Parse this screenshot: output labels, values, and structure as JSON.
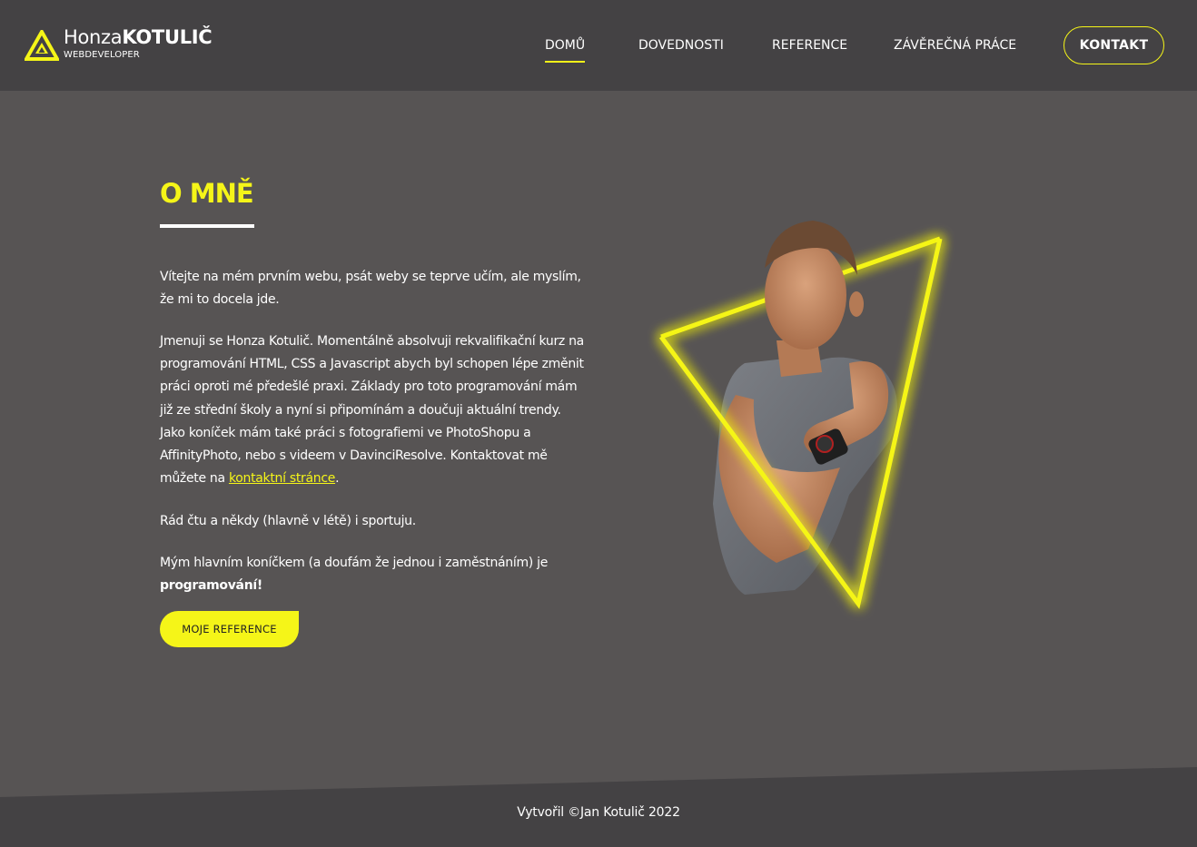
{
  "brand": {
    "first_name": "Honza",
    "last_name": "KOTULIČ",
    "tagline": "WEBDEVELOPER",
    "accent_color": "#f5f518"
  },
  "nav": {
    "items": [
      {
        "label": "DOMŮ",
        "active": true
      },
      {
        "label": "DOVEDNOSTI",
        "active": false
      },
      {
        "label": "REFERENCE",
        "active": false
      },
      {
        "label": "ZÁVĚREČNÁ PRÁCE",
        "active": false
      }
    ],
    "contact_label": "KONTAKT"
  },
  "main": {
    "title": "O MNĚ",
    "para1": "Vítejte na mém prvním webu, psát weby se teprve učím, ale myslím, že mi to docela jde.",
    "para2": "Jmenuji se Honza Kotulič. Momentálně absolvuji rekvalifikační kurz na programování HTML, CSS a Javascript abych byl schopen lépe změnit práci oproti mé předešlé praxi. Základy pro toto programování mám již ze střední školy a nyní si připomínám a doučuji aktuální trendy. Jako koníček mám také práci s fotografiemi ve PhotoShopu a AffinityPhoto, nebo s videem v DavinciResolve. Kontaktovat mě můžete na ",
    "para2_link": "kontaktní stránce",
    "para2_end": ".",
    "para3": "Rád čtu a někdy (hlavně v létě) i sportuju.",
    "para4": "Mým hlavním koníčkem (a doufám že jednou i zaměstnáním) je ",
    "para4_bold": "programování!",
    "button_label": "MOJE REFERENCE"
  },
  "footer": {
    "text": "Vytvořil ©Jan Kotulič 2022"
  }
}
